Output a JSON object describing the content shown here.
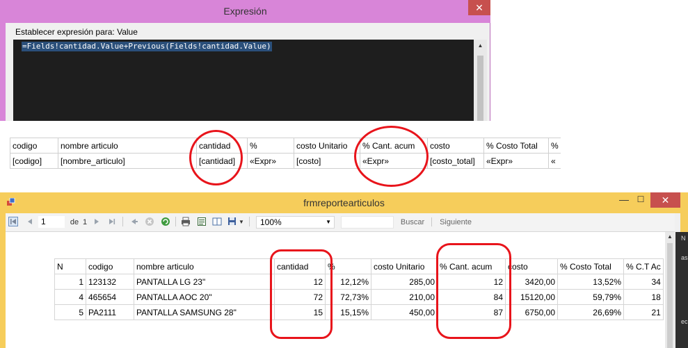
{
  "expression_dialog": {
    "title": "Expresión",
    "close_glyph": "✕",
    "label": "Establecer expresión para: Value",
    "expression": "=Fields!cantidad.Value+Previous(Fields!cantidad.Value)"
  },
  "design_table": {
    "headers": [
      "codigo",
      "nombre articulo",
      "cantidad",
      "%",
      "costo Unitario",
      "% Cant. acum",
      "costo",
      "% Costo Total",
      "%"
    ],
    "fields": [
      "[codigo]",
      "[nombre_articulo]",
      "[cantidad]",
      "«Expr»",
      "[costo]",
      "«Expr»",
      "[costo_total]",
      "«Expr»",
      "«"
    ]
  },
  "report_form": {
    "title": "frmreportearticulos",
    "minimize_glyph": "—",
    "maximize_glyph": "☐",
    "close_glyph": "✕",
    "toolbar": {
      "page_value": "1",
      "of_label": "de",
      "total_pages": "1",
      "zoom_value": "100%",
      "search_label": "Buscar",
      "next_label": "Siguiente"
    },
    "table": {
      "headers": [
        "N",
        "codigo",
        "nombre articulo",
        "cantidad",
        "%",
        "costo Unitario",
        "% Cant. acum",
        "costo",
        "% Costo Total",
        "% C.T Ac"
      ],
      "rows": [
        [
          "1",
          "123132",
          "PANTALLA LG 23\"",
          "12",
          "12,12%",
          "285,00",
          "12",
          "3420,00",
          "13,52%",
          "34"
        ],
        [
          "4",
          "465654",
          "PANTALLA AOC 20\"",
          "72",
          "72,73%",
          "210,00",
          "84",
          "15120,00",
          "59,79%",
          "18"
        ],
        [
          "5",
          "PA2111",
          "PANTALLA SAMSUNG 28\"",
          "15",
          "15,15%",
          "450,00",
          "87",
          "6750,00",
          "26,69%",
          "21"
        ]
      ]
    }
  },
  "side_strip": {
    "texts": [
      "N",
      "as",
      "ec"
    ]
  },
  "colors": {
    "expr_title_bg": "#d885d8",
    "form_title_bg": "#f6cd5b",
    "close_bg": "#c7504e",
    "editor_bg": "#1e1e1e",
    "selection_bg": "#2a4f7a",
    "annotation_red": "#e8141b"
  }
}
